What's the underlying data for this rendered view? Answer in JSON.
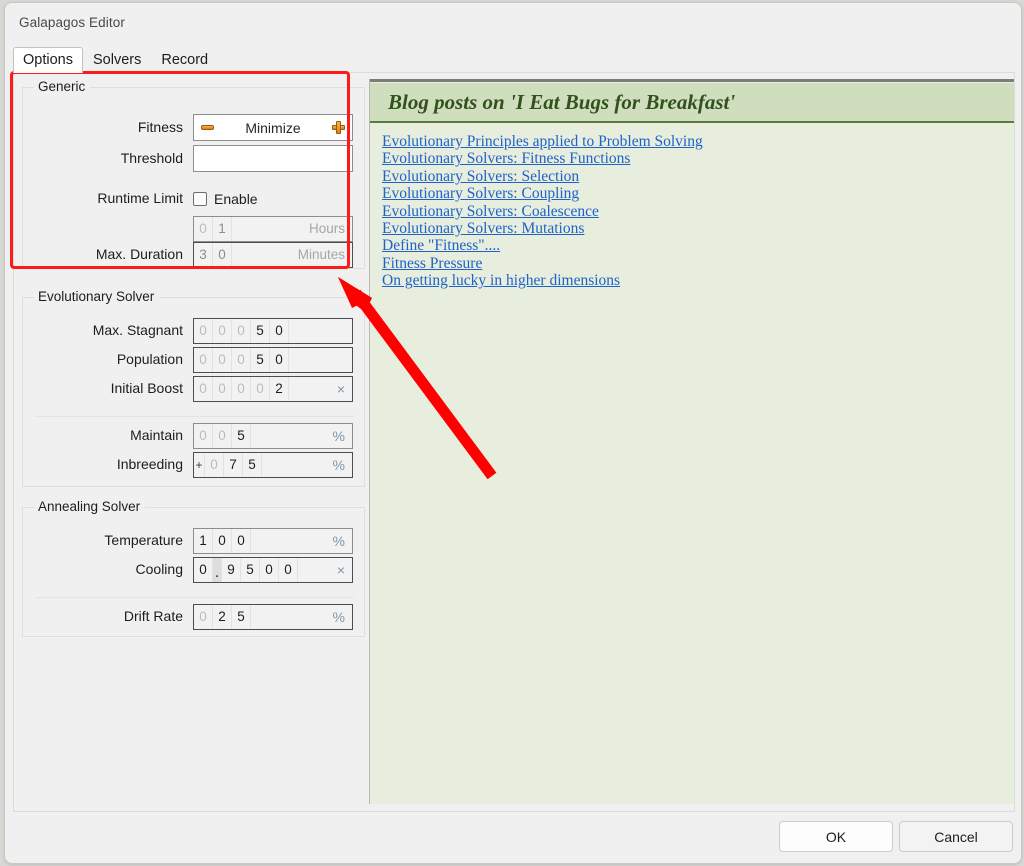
{
  "window": {
    "title": "Galapagos Editor"
  },
  "tabs": [
    {
      "label": "Options",
      "active": true
    },
    {
      "label": "Solvers",
      "active": false
    },
    {
      "label": "Record",
      "active": false
    }
  ],
  "groups": {
    "generic": {
      "legend": "Generic",
      "fitness": {
        "label": "Fitness",
        "value": "Minimize",
        "minus_icon": "minus-icon",
        "plus_icon": "plus-icon"
      },
      "threshold": {
        "label": "Threshold",
        "value": "",
        "placeholder": ""
      },
      "runtime_limit": {
        "label": "Runtime Limit",
        "checkbox_label": "Enable",
        "checked": false
      },
      "max_duration": {
        "label": "Max. Duration",
        "hours": {
          "digits": [
            "0",
            "1"
          ],
          "dim": [
            true,
            false
          ],
          "unit": "Hours"
        },
        "minutes": {
          "digits": [
            "3",
            "0"
          ],
          "dim": [
            true,
            true
          ],
          "unit": "Minutes"
        }
      }
    },
    "evolutionary": {
      "legend": "Evolutionary Solver",
      "rows": [
        {
          "label": "Max. Stagnant",
          "digits": [
            "0",
            "0",
            "0",
            "5",
            "0"
          ],
          "dim": [
            true,
            true,
            true,
            false,
            false
          ],
          "unit": ""
        },
        {
          "label": "Population",
          "digits": [
            "0",
            "0",
            "0",
            "5",
            "0"
          ],
          "dim": [
            true,
            true,
            true,
            false,
            false
          ],
          "unit": ""
        },
        {
          "label": "Initial Boost",
          "digits": [
            "0",
            "0",
            "0",
            "0",
            "2"
          ],
          "dim": [
            true,
            true,
            true,
            true,
            false
          ],
          "unit": "×"
        },
        {
          "label": "Maintain",
          "digits": [
            "0",
            "0",
            "5"
          ],
          "dim": [
            true,
            true,
            false
          ],
          "unit": "%"
        },
        {
          "label": "Inbreeding",
          "sign": "+",
          "digits": [
            "0",
            "7",
            "5"
          ],
          "dim": [
            true,
            false,
            false
          ],
          "unit": "%"
        }
      ]
    },
    "annealing": {
      "legend": "Annealing Solver",
      "rows": [
        {
          "label": "Temperature",
          "digits": [
            "1",
            "0",
            "0"
          ],
          "dim": [
            false,
            false,
            false
          ],
          "unit": "%"
        },
        {
          "label": "Cooling",
          "digits": [
            "0",
            ".",
            "9",
            "5",
            "0",
            "0"
          ],
          "dim": [
            false,
            false,
            false,
            false,
            false,
            false
          ],
          "unit": "×"
        },
        {
          "label": "Drift Rate",
          "digits": [
            "0",
            "2",
            "5"
          ],
          "dim": [
            true,
            false,
            false
          ],
          "unit": "%"
        }
      ]
    }
  },
  "blog": {
    "heading": "Blog posts on 'I Eat Bugs for Breakfast'",
    "links": [
      "Evolutionary Principles applied to Problem Solving",
      "Evolutionary Solvers: Fitness Functions",
      "Evolutionary Solvers: Selection",
      "Evolutionary Solvers: Coupling",
      "Evolutionary Solvers: Coalescence",
      "Evolutionary Solvers: Mutations",
      "Define \"Fitness\"....",
      "Fitness Pressure",
      "On getting lucky in higher dimensions"
    ]
  },
  "buttons": {
    "ok": "OK",
    "cancel": "Cancel"
  },
  "annotation": {
    "highlight_color": "#ff1a1a",
    "arrow_color": "#ff0000"
  },
  "colors": {
    "accent_orange": "#e07d18",
    "panel_green": "#e7eedd",
    "header_green": "#cfdfbe",
    "link_blue": "#1f62c9",
    "heading_green": "#33501f"
  }
}
